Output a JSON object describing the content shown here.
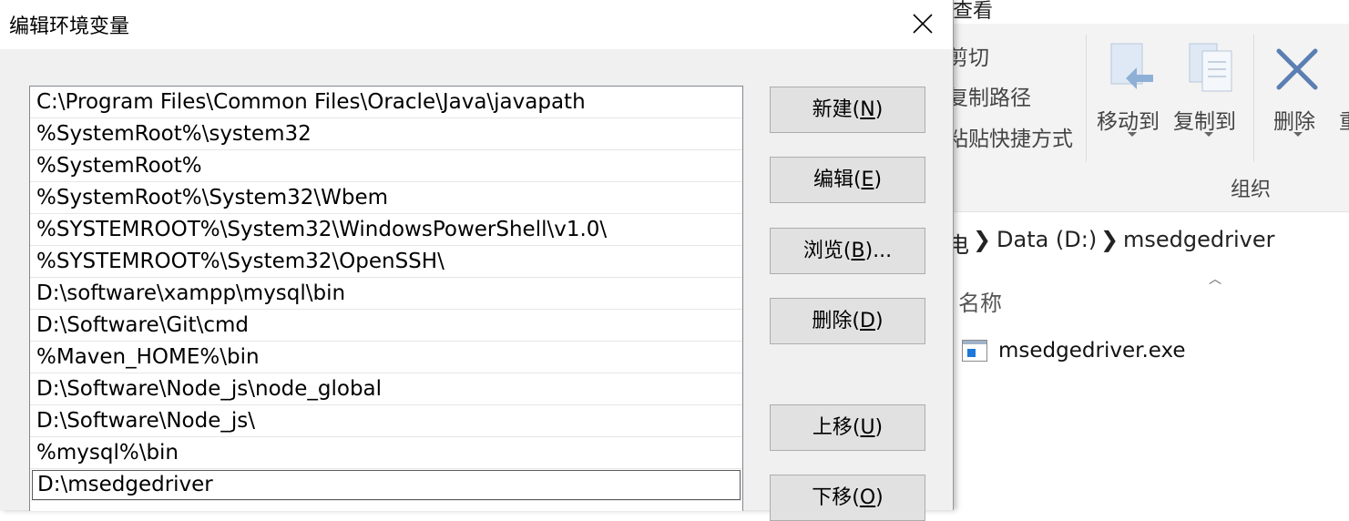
{
  "dialog": {
    "title": "编辑环境变量",
    "path_entries": [
      "C:\\Program Files\\Common Files\\Oracle\\Java\\javapath",
      "%SystemRoot%\\system32",
      "%SystemRoot%",
      "%SystemRoot%\\System32\\Wbem",
      "%SYSTEMROOT%\\System32\\WindowsPowerShell\\v1.0\\",
      "%SYSTEMROOT%\\System32\\OpenSSH\\",
      "D:\\software\\xampp\\mysql\\bin",
      "D:\\Software\\Git\\cmd",
      "%Maven_HOME%\\bin",
      "D:\\Software\\Node_js\\node_global",
      "D:\\Software\\Node_js\\",
      "%mysql%\\bin",
      "D:\\msedgedriver"
    ],
    "selected_entry": "D:\\msedgedriver",
    "buttons": {
      "new": {
        "label": "新建(",
        "key": "N",
        "suffix": ")"
      },
      "edit": {
        "label": "编辑(",
        "key": "E",
        "suffix": ")"
      },
      "browse": {
        "label": "浏览(",
        "key": "B",
        "suffix": ")..."
      },
      "delete": {
        "label": "删除(",
        "key": "D",
        "suffix": ")"
      },
      "move_up": {
        "label": "上移(",
        "key": "U",
        "suffix": ")"
      },
      "move_down": {
        "label": "下移(",
        "key": "O",
        "suffix": ")"
      }
    }
  },
  "explorer": {
    "tab_partial": "查看",
    "ribbon": {
      "cut_partial": "剪切",
      "copy_path_partial": "复制路径",
      "paste_shortcut_partial": "粘贴快捷方式",
      "move_to": "移动到",
      "copy_to": "复制到",
      "delete": "删除",
      "rename_partial": "重",
      "group_label": "组织"
    },
    "address": {
      "partial": "电",
      "segments": [
        "Data (D:)",
        "msedgedriver"
      ]
    },
    "column_header": "名称",
    "files": [
      "msedgedriver.exe"
    ]
  },
  "colors": {
    "dialog_bg": "#f0f0f0",
    "button_bg": "#e1e1e1",
    "ribbon_bg": "#f3f3f3",
    "file_icon_accent": "#1e78d7"
  }
}
